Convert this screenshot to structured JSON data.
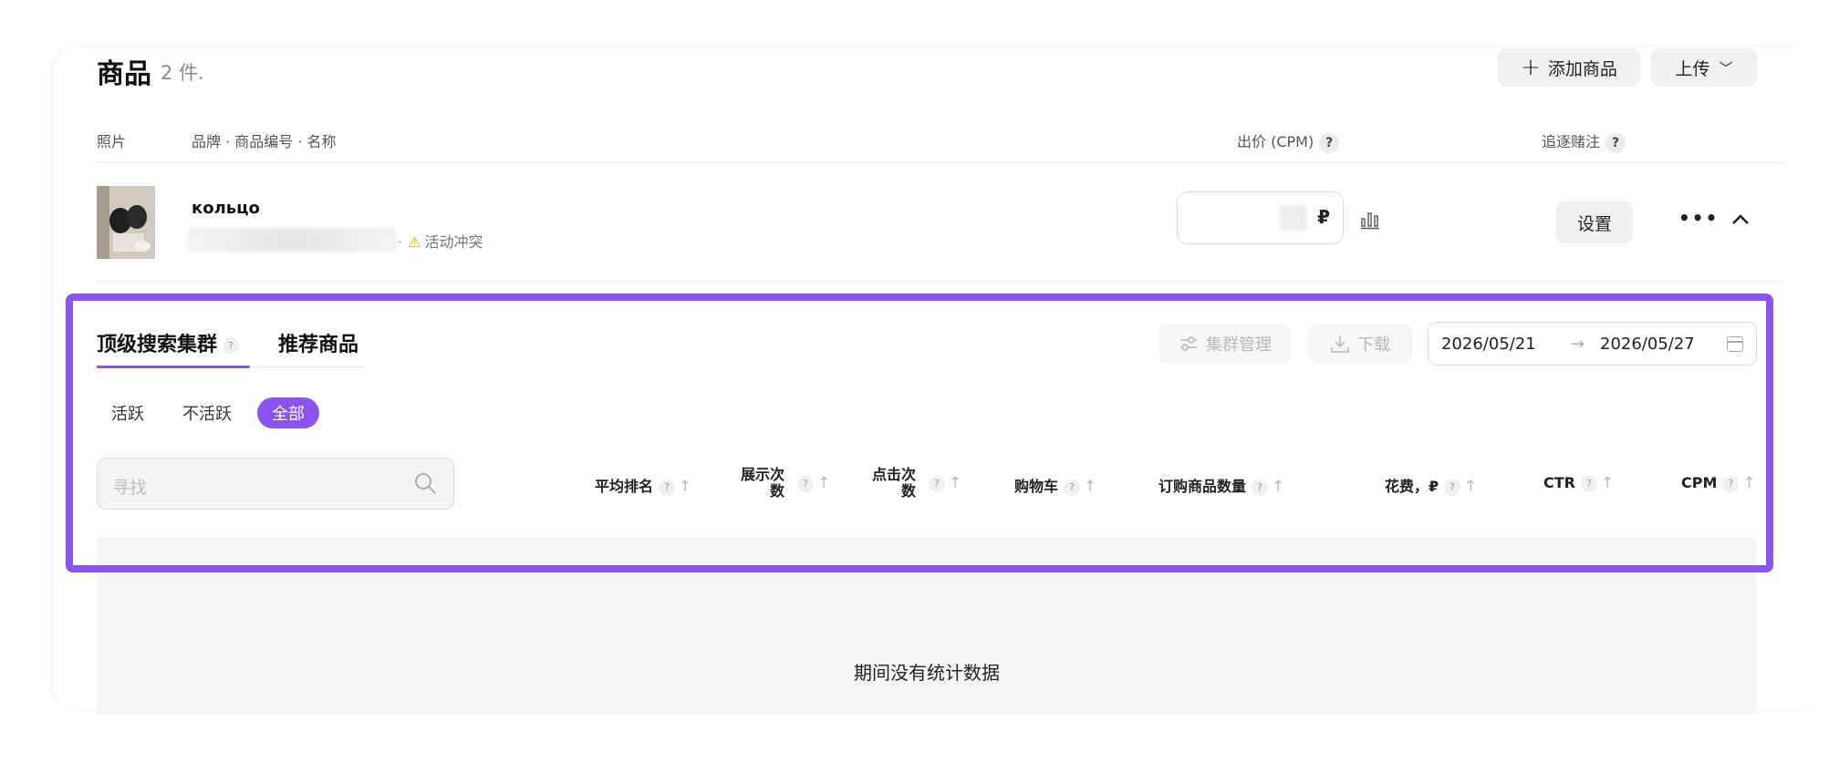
{
  "header": {
    "title": "商品",
    "count": "2 件.",
    "add_label": "添加商品",
    "upload_label": "上传"
  },
  "columns": {
    "photo": "照片",
    "brand": "品牌 · 商品编号 · 名称",
    "bid": "出价 (CPM)",
    "tracking": "追逐赌注"
  },
  "product": {
    "name": "кольцо",
    "conflict": "活动冲突",
    "currency": "₽",
    "set_label": "设置"
  },
  "tabs": {
    "top_clusters": "顶级搜索集群",
    "recommended": "推荐商品"
  },
  "toolbar": {
    "cluster_mgmt": "集群管理",
    "download": "下载",
    "date_from": "2026/05/21",
    "date_to": "2026/05/27"
  },
  "filters": {
    "active": "活跃",
    "inactive": "不活跃",
    "all": "全部"
  },
  "search": {
    "placeholder": "寻找"
  },
  "table_headers": {
    "avg_rank": "平均排名",
    "impressions_1": "展示次",
    "impressions_2": "数",
    "clicks_1": "点击次",
    "clicks_2": "数",
    "cart": "购物车",
    "ordered": "订购商品数量",
    "spend": "花费，₽",
    "ctr": "CTR",
    "cpm": "CPM"
  },
  "empty_message": "期间没有统计数据",
  "colors": {
    "accent": "#8b53f1",
    "warning": "#e8a317"
  }
}
